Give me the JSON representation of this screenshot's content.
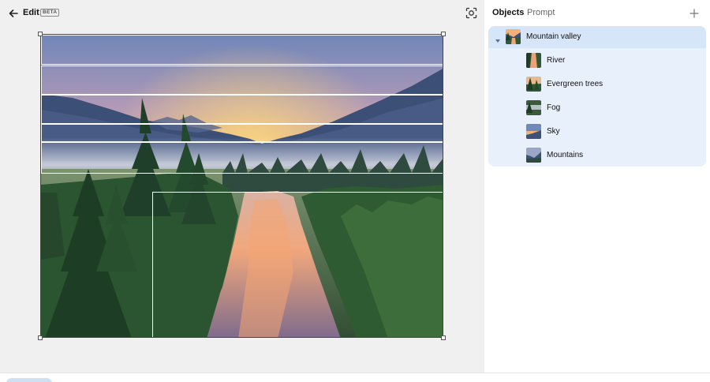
{
  "header": {
    "title": "Edit",
    "badge": "BETA"
  },
  "panel": {
    "tabs": [
      {
        "label": "Objects",
        "active": true
      },
      {
        "label": "Prompt",
        "active": false
      }
    ],
    "tree": {
      "root": {
        "label": "Mountain valley",
        "expanded": true
      },
      "children": [
        {
          "label": "River"
        },
        {
          "label": "Evergreen trees"
        },
        {
          "label": "Fog"
        },
        {
          "label": "Sky"
        },
        {
          "label": "Mountains"
        }
      ]
    }
  },
  "colors": {
    "accent": "#d6e6f8",
    "tree_bg": "#e7f0fb",
    "sunset": "#f8b45a"
  },
  "icons": {
    "back": "arrow-left-icon",
    "scan": "focus-scan-icon",
    "add": "plus-icon",
    "caret": "caret-down-icon"
  }
}
